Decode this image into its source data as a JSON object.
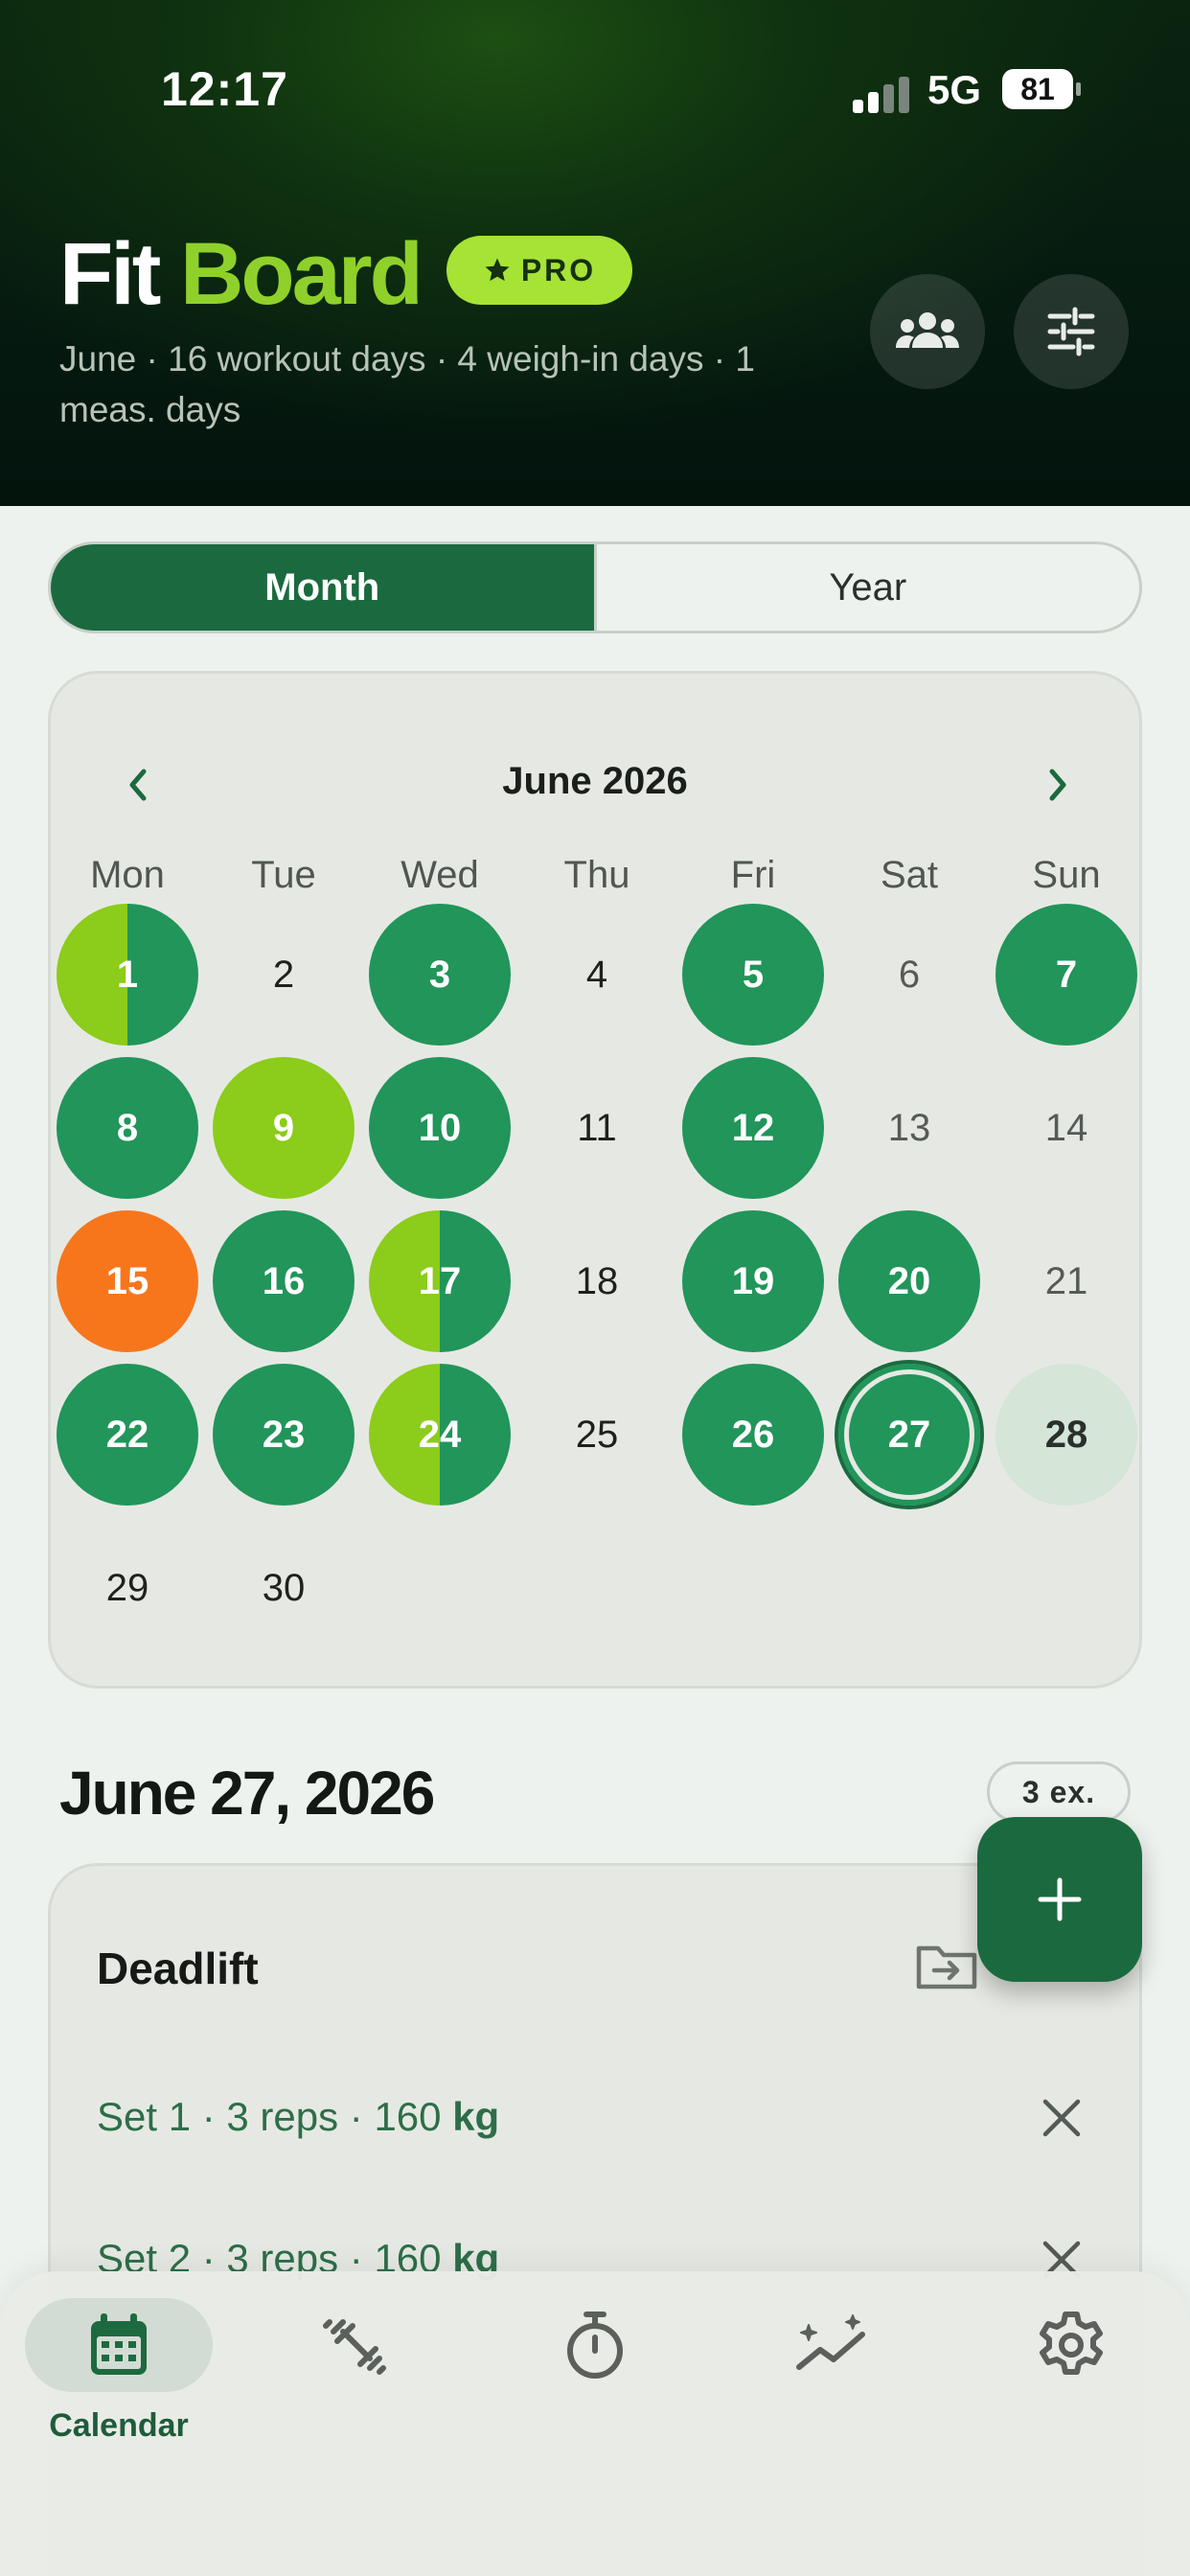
{
  "status_bar": {
    "time": "12:17",
    "network": "5G",
    "battery": "81"
  },
  "header": {
    "title_part1": "Fit",
    "title_part2": "Board",
    "pro_badge": "PRO",
    "subtitle": "June · 16 workout days · 4 weigh-in days · 1 meas. days",
    "icons": [
      "people-icon",
      "sliders-icon"
    ]
  },
  "view_toggle": {
    "options": [
      "Month",
      "Year"
    ],
    "selected": "Month"
  },
  "calendar": {
    "month_label": "June 2026",
    "weekdays": [
      "Mon",
      "Tue",
      "Wed",
      "Thu",
      "Fri",
      "Sat",
      "Sun"
    ],
    "days": [
      {
        "label": "1",
        "type": "split"
      },
      {
        "label": "2",
        "type": "plain"
      },
      {
        "label": "3",
        "type": "workout"
      },
      {
        "label": "4",
        "type": "plain"
      },
      {
        "label": "5",
        "type": "workout"
      },
      {
        "label": "6",
        "type": "weekend"
      },
      {
        "label": "7",
        "type": "workout"
      },
      {
        "label": "8",
        "type": "workout"
      },
      {
        "label": "9",
        "type": "weighin"
      },
      {
        "label": "10",
        "type": "workout"
      },
      {
        "label": "11",
        "type": "plain"
      },
      {
        "label": "12",
        "type": "workout"
      },
      {
        "label": "13",
        "type": "weekend"
      },
      {
        "label": "14",
        "type": "weekend"
      },
      {
        "label": "15",
        "type": "measure"
      },
      {
        "label": "16",
        "type": "workout"
      },
      {
        "label": "17",
        "type": "split"
      },
      {
        "label": "18",
        "type": "plain"
      },
      {
        "label": "19",
        "type": "workout"
      },
      {
        "label": "20",
        "type": "workout"
      },
      {
        "label": "21",
        "type": "weekend"
      },
      {
        "label": "22",
        "type": "workout"
      },
      {
        "label": "23",
        "type": "workout"
      },
      {
        "label": "24",
        "type": "split"
      },
      {
        "label": "25",
        "type": "plain"
      },
      {
        "label": "26",
        "type": "workout"
      },
      {
        "label": "27",
        "type": "today"
      },
      {
        "label": "28",
        "type": "planned"
      },
      {
        "label": "29",
        "type": "plain"
      },
      {
        "label": "30",
        "type": "plain"
      }
    ],
    "colors": {
      "workout": "#21955a",
      "weighin": "#8ccc1b",
      "measure": "#f7761c",
      "accent": "#1b6a3f"
    }
  },
  "selected_day": {
    "date_label": "June 27, 2026",
    "exercise_count": "3 ex.",
    "exercise": {
      "name": "Deadlift",
      "sets": [
        {
          "prefix": "Set 1 · 3 reps · 160 ",
          "unit": "kg"
        },
        {
          "prefix": "Set 2 · 3 reps · 160 ",
          "unit": "kg"
        }
      ]
    }
  },
  "tab_bar": {
    "tabs": [
      {
        "label": "Calendar",
        "icon": "calendar-icon",
        "active": true
      },
      {
        "label": "",
        "icon": "dumbbell-icon",
        "active": false
      },
      {
        "label": "",
        "icon": "stopwatch-icon",
        "active": false
      },
      {
        "label": "",
        "icon": "chart-sparkle-icon",
        "active": false
      },
      {
        "label": "",
        "icon": "gear-icon",
        "active": false
      }
    ]
  }
}
